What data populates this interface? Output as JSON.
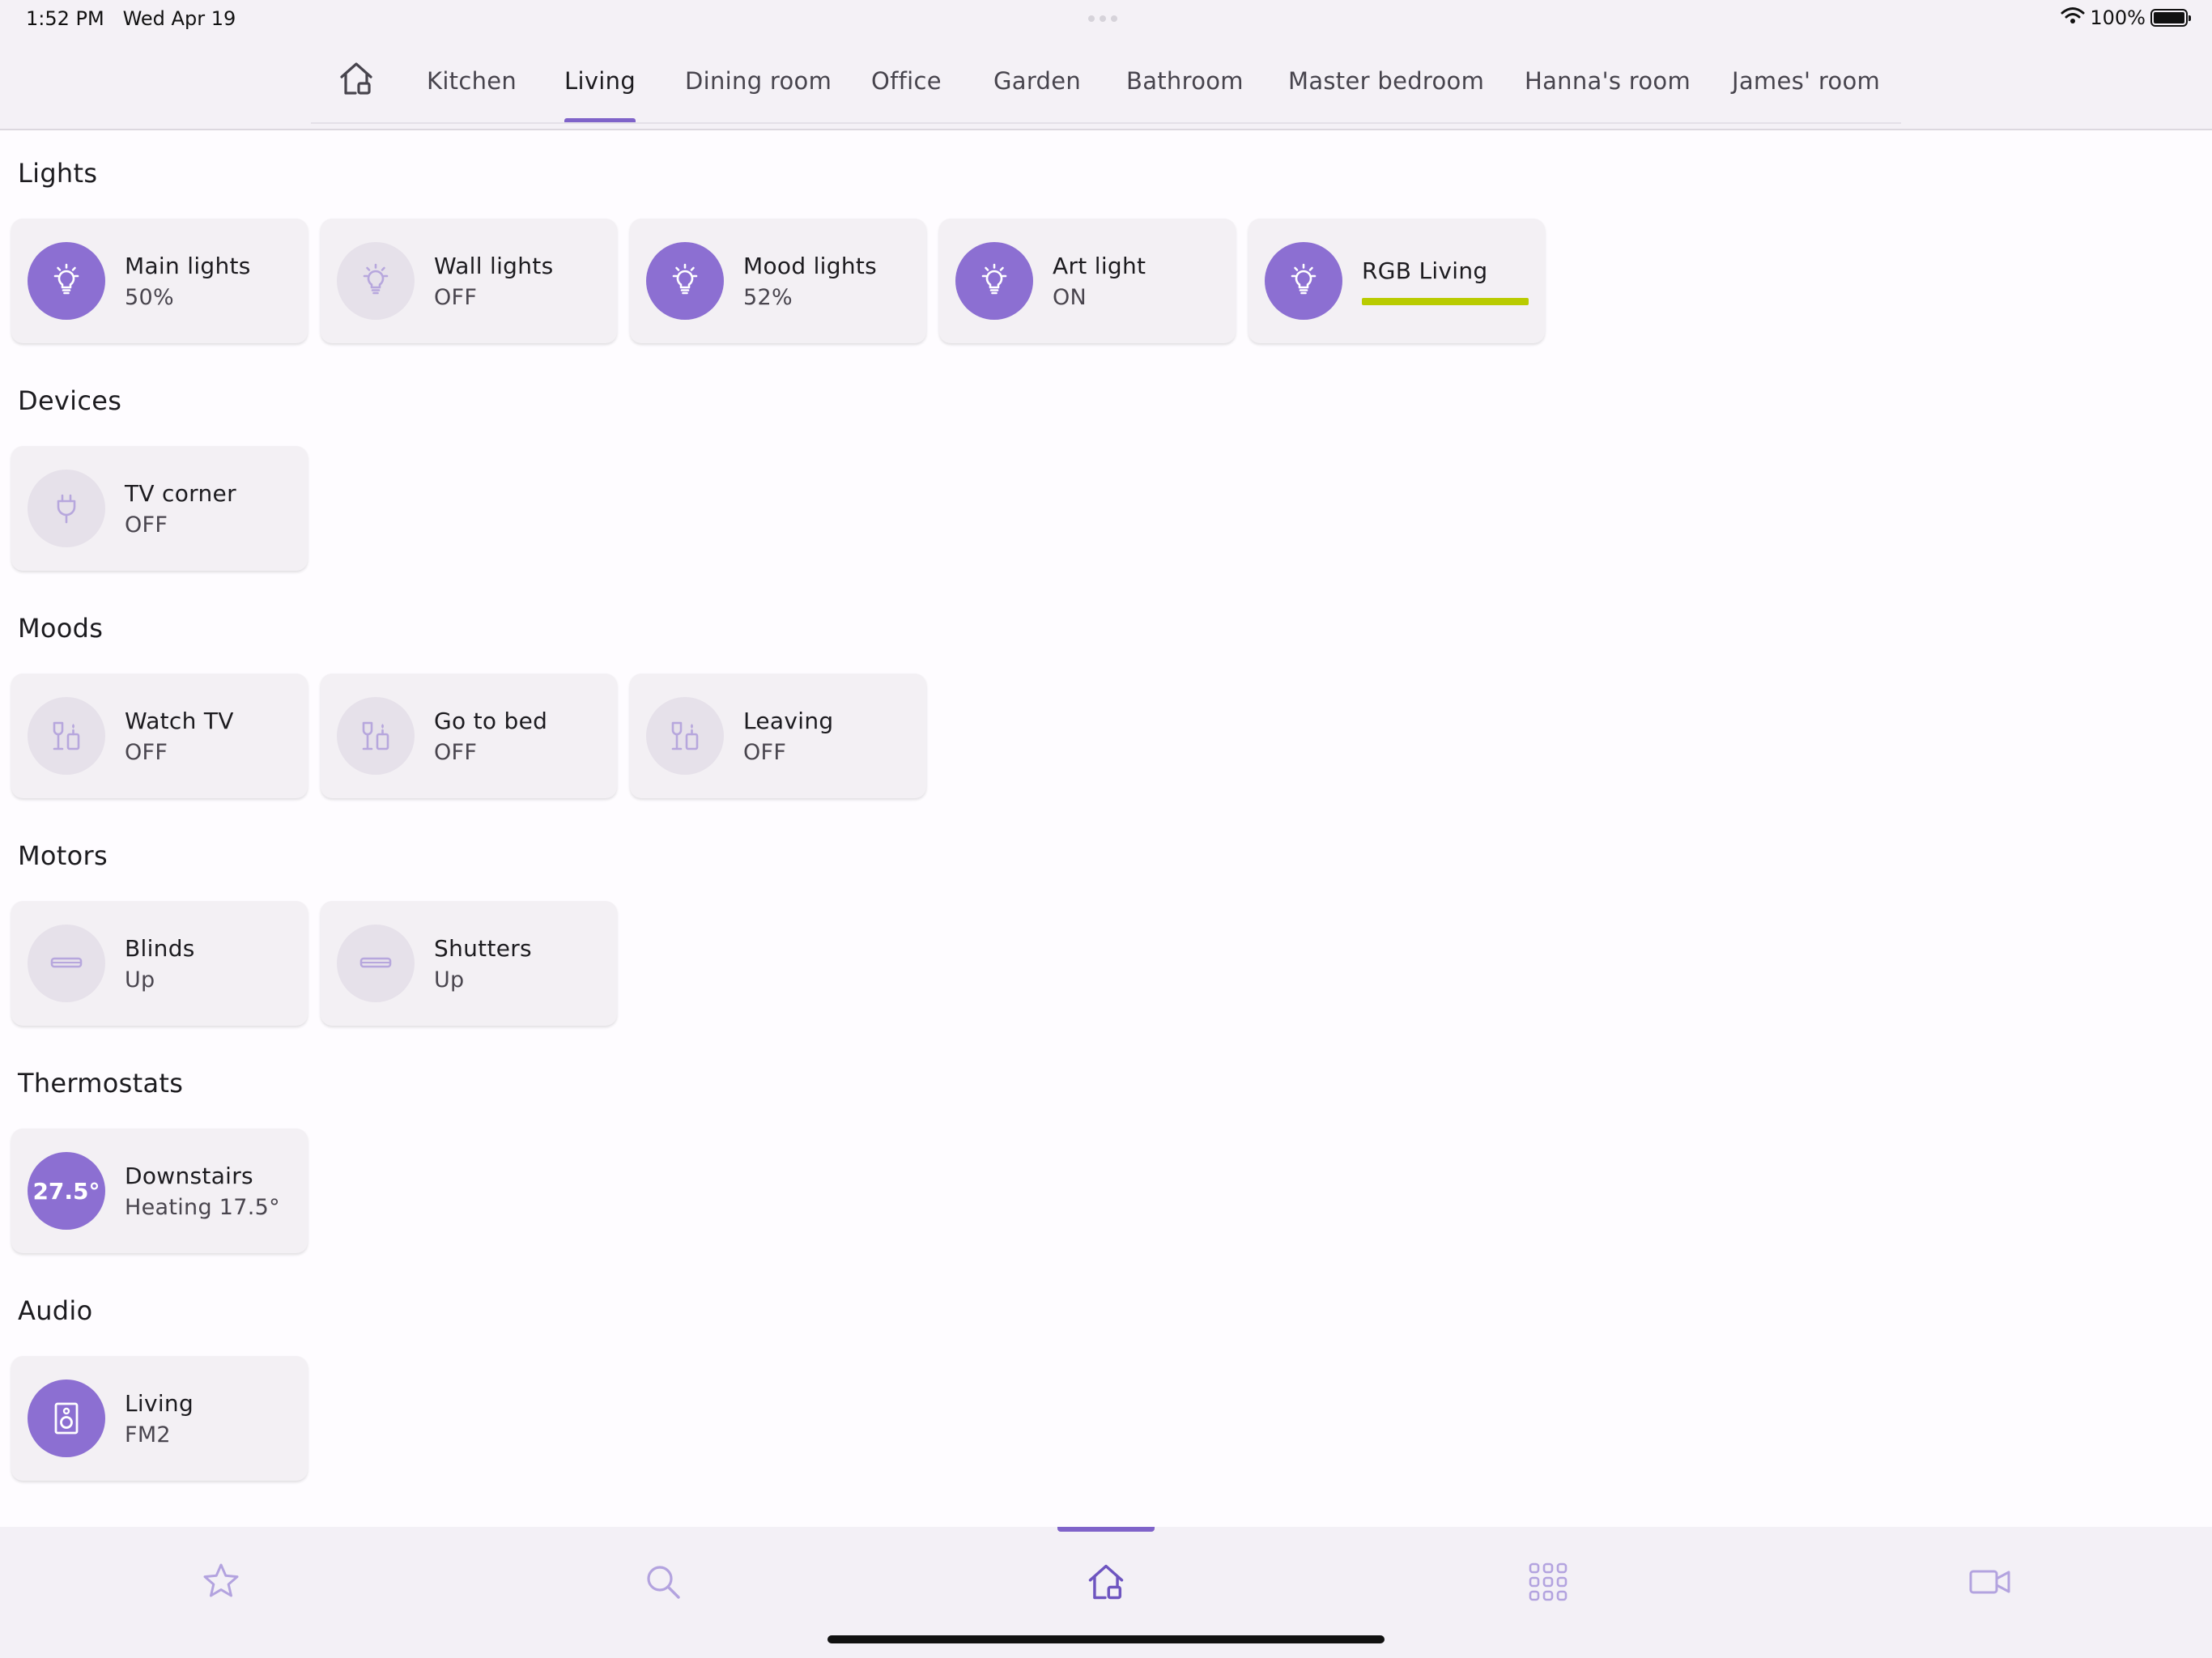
{
  "status_bar": {
    "time": "1:52 PM",
    "date": "Wed Apr 19",
    "battery": "100%"
  },
  "tabs": [
    {
      "id": "home",
      "icon": "home-icon"
    },
    {
      "id": "kitchen",
      "label": "Kitchen"
    },
    {
      "id": "living",
      "label": "Living",
      "active": true
    },
    {
      "id": "dining",
      "label": "Dining room"
    },
    {
      "id": "office",
      "label": "Office"
    },
    {
      "id": "garden",
      "label": "Garden"
    },
    {
      "id": "bathroom",
      "label": "Bathroom"
    },
    {
      "id": "master",
      "label": "Master bedroom"
    },
    {
      "id": "hanna",
      "label": "Hanna's room"
    },
    {
      "id": "james",
      "label": "James' room"
    }
  ],
  "sections": {
    "lights": {
      "title": "Lights",
      "items": [
        {
          "name": "Main lights",
          "state": "50%",
          "icon": "bulb-icon",
          "on": true
        },
        {
          "name": "Wall lights",
          "state": "OFF",
          "icon": "bulb-icon",
          "on": false
        },
        {
          "name": "Mood lights",
          "state": "52%",
          "icon": "bulb-icon",
          "on": true
        },
        {
          "name": "Art light",
          "state": "ON",
          "icon": "bulb-icon",
          "on": true
        },
        {
          "name": "RGB Living",
          "icon": "bulb-icon",
          "on": true,
          "rgb_color": "#b9cb00"
        }
      ]
    },
    "devices": {
      "title": "Devices",
      "items": [
        {
          "name": "TV corner",
          "state": "OFF",
          "icon": "plug-icon",
          "on": false
        }
      ]
    },
    "moods": {
      "title": "Moods",
      "items": [
        {
          "name": "Watch TV",
          "state": "OFF",
          "icon": "mood-icon",
          "on": false
        },
        {
          "name": "Go to bed",
          "state": "OFF",
          "icon": "mood-icon",
          "on": false
        },
        {
          "name": "Leaving",
          "state": "OFF",
          "icon": "mood-icon",
          "on": false
        }
      ]
    },
    "motors": {
      "title": "Motors",
      "items": [
        {
          "name": "Blinds",
          "state": "Up",
          "icon": "blind-icon",
          "on": false
        },
        {
          "name": "Shutters",
          "state": "Up",
          "icon": "blind-icon",
          "on": false
        }
      ]
    },
    "thermostats": {
      "title": "Thermostats",
      "items": [
        {
          "name": "Downstairs",
          "state": "Heating 17.5°",
          "temperature": "27.5°",
          "on": true
        }
      ]
    },
    "audio": {
      "title": "Audio",
      "items": [
        {
          "name": "Living",
          "state": "FM2",
          "icon": "speaker-icon",
          "on": true
        }
      ]
    }
  },
  "bottom_nav": [
    {
      "id": "favorites",
      "icon": "star-icon"
    },
    {
      "id": "search",
      "icon": "search-icon"
    },
    {
      "id": "home",
      "icon": "home-icon",
      "active": true
    },
    {
      "id": "apps",
      "icon": "grid-icon"
    },
    {
      "id": "cameras",
      "icon": "video-camera-icon"
    }
  ],
  "colors": {
    "accent": "#8c6fd2",
    "accent_dark": "#7f63c9",
    "icon_off_bg": "#e6e1ea",
    "icon_off_fg": "#b7a7dd",
    "card_bg": "#f3f0f4",
    "rgb_living": "#b9cb00"
  }
}
